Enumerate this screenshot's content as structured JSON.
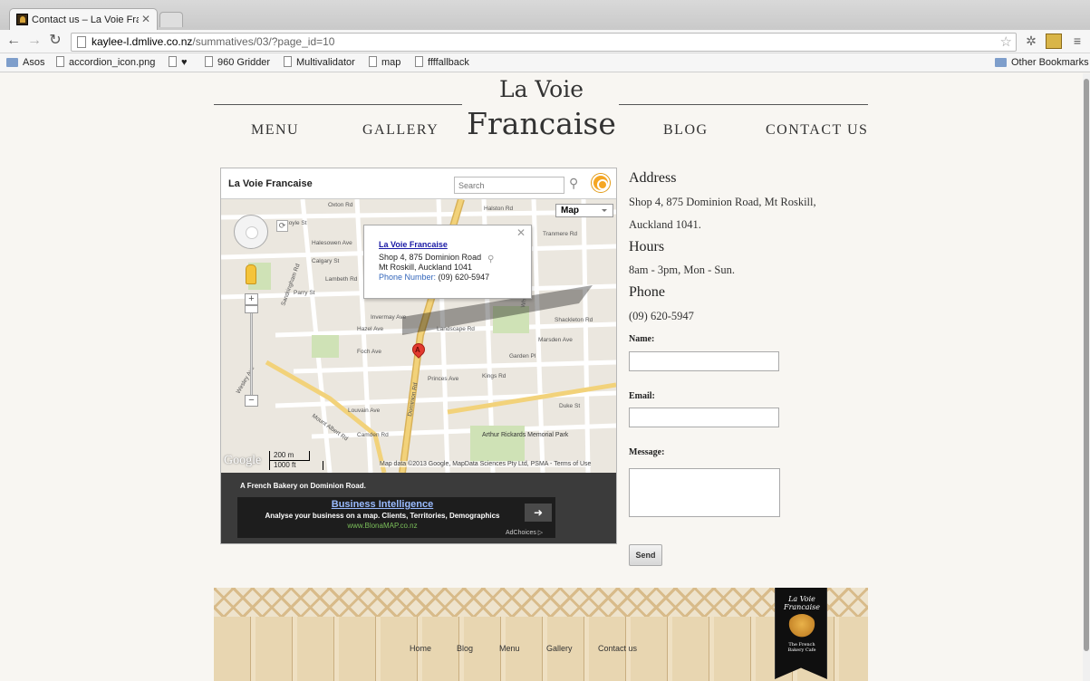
{
  "browser": {
    "tab_title": "Contact us – La Voie Franc",
    "tab_close": "✕",
    "url_host": "kaylee-l.dmlive.co.nz",
    "url_path": "/summatives/03/?page_id=10",
    "bookmarks": [
      "Asos",
      "accordion_icon.png",
      "♥",
      "960 Gridder",
      "Multivalidator",
      "map",
      "ffffallback"
    ],
    "other_bookmarks": "Other Bookmarks"
  },
  "site": {
    "logo_line1": "La Voie",
    "logo_line2": "Francaise",
    "nav": [
      "MENU",
      "GALLERY",
      "BLOG",
      "CONTACT US"
    ]
  },
  "map": {
    "title": "La Voie Francaise",
    "search_placeholder": "Search",
    "map_type": "Map",
    "info": {
      "name": "La Voie Francaise",
      "address_line1": "Shop 4, 875 Dominion Road",
      "address_line2": "Mt Roskill, Auckland 1041",
      "phone_label": "Phone Number:",
      "phone": "(09) 620-5947"
    },
    "marker_label": "A",
    "streets": [
      "Oxton Rd",
      "Halston Rd",
      "Coyle St",
      "Halesowen Ave",
      "Calgary St",
      "Tranmere Rd",
      "Parry St",
      "Lambeth Rd",
      "Sandringham Rd",
      "Invermay Ave",
      "Hazel Ave",
      "Foch Ave",
      "Landscape Rd",
      "Dominion Rd",
      "Princes Ave",
      "Kings Rd",
      "Duke St",
      "Louvain Ave",
      "Mount Albert Rd",
      "Shackleton Rd",
      "Whitworth Rd",
      "Arthur Rickards Memorial Park",
      "Camden Rd",
      "Garden Pl",
      "Wesley Ave",
      "Marsden Ave"
    ],
    "logo": "Google",
    "scale_m": "200 m",
    "scale_ft": "1000 ft",
    "attribution": "Map data ©2013 Google, MapData Sciences Pty Ltd, PSMA - Terms of Use",
    "footer_desc": "A French Bakery on Dominion Road.",
    "ad": {
      "headline": "Business Intelligence",
      "body": "Analyse your business on a map. Clients, Territories, Demographics",
      "url": "www.BlonaMAP.co.nz",
      "adchoices": "AdChoices ▷"
    }
  },
  "contact": {
    "address_heading": "Address",
    "address_line1": "Shop 4, 875 Dominion Road, Mt Roskill,",
    "address_line2": "Auckland 1041.",
    "hours_heading": "Hours",
    "hours": "8am - 3pm, Mon - Sun.",
    "phone_heading": "Phone",
    "phone": "(09) 620-5947",
    "form": {
      "name_label": "Name:",
      "email_label": "Email:",
      "message_label": "Message:",
      "send_label": "Send"
    }
  },
  "footer": {
    "links": [
      "Home",
      "Blog",
      "Menu",
      "Gallery",
      "Contact us"
    ],
    "badge_title1": "La Voie",
    "badge_title2": "Francaise",
    "badge_sub1": "The French",
    "badge_sub2": "Bakery Cafe"
  },
  "colors": {
    "marker": "#e2392f",
    "ad_link": "#99bbff",
    "ad_url": "#7bbf5a"
  }
}
